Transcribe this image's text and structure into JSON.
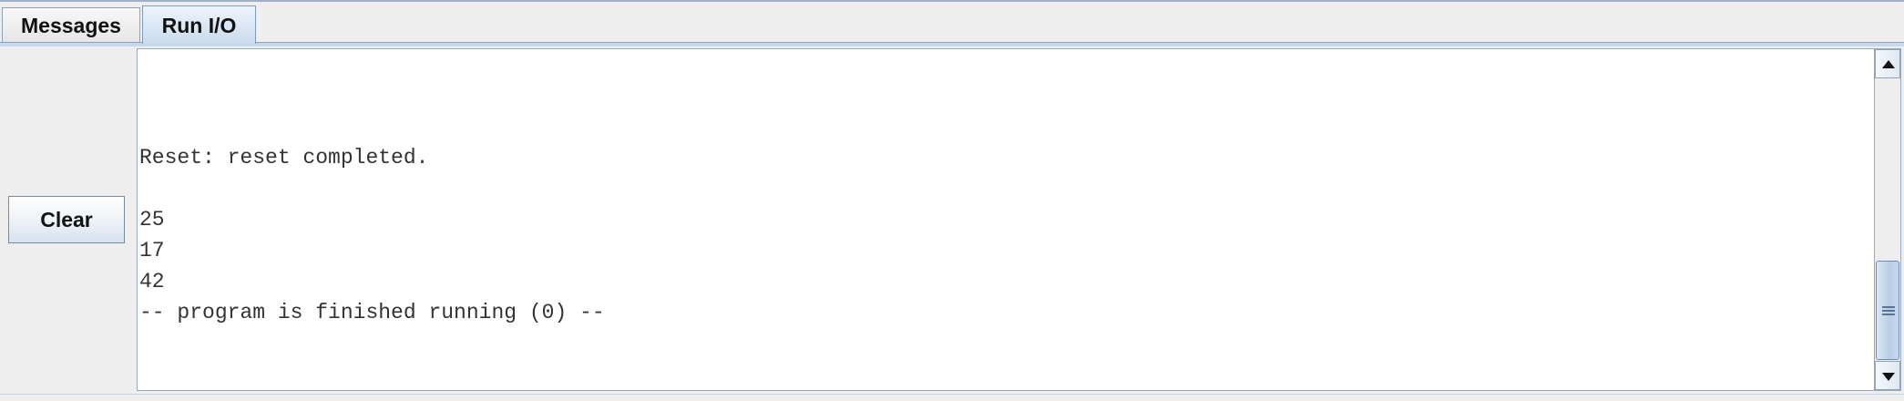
{
  "tabs": [
    {
      "label": "Messages",
      "active": false
    },
    {
      "label": "Run I/O",
      "active": true
    }
  ],
  "left_panel": {
    "clear_label": "Clear"
  },
  "output": {
    "lines": [
      "",
      "",
      "",
      "Reset: reset completed.",
      "",
      "25",
      "17",
      "42",
      "-- program is finished running (0) --"
    ]
  },
  "scrollbar": {
    "position": "bottom"
  },
  "colors": {
    "background": "#eeeeee",
    "active_tab": "#c9dbee",
    "text": "#333333"
  }
}
